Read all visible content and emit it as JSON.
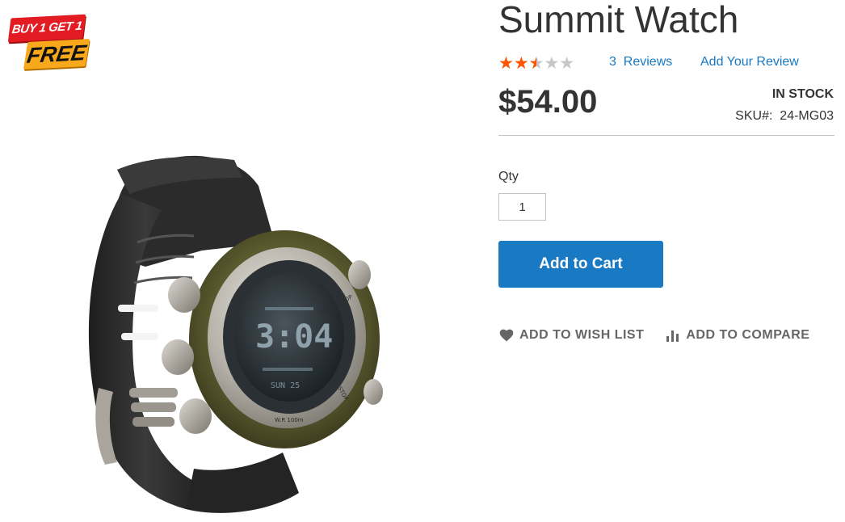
{
  "promo_badge": {
    "line1": "BUY 1 GET 1",
    "line2": "FREE"
  },
  "product": {
    "title": "Summit Watch",
    "rating": {
      "value": 2.5,
      "max": 5,
      "fill_color": "#ff5501",
      "empty_color": "#c7c7c7"
    },
    "reviews_link": "3  Reviews",
    "add_review_link": "Add Your Review",
    "price": "$54.00",
    "stock_status": "In stock",
    "sku_text": "SKU#:  24-MG03",
    "qty_label": "Qty",
    "qty_value": "1",
    "add_to_cart_label": "Add to Cart",
    "wishlist_label": "Add to Wish List",
    "compare_label": "Add to Compare",
    "image_alt": "Summit Watch"
  },
  "colors": {
    "accent": "#1979c3",
    "text": "#333333",
    "secondary_text": "#666666"
  },
  "icons": {
    "wishlist": "heart-icon",
    "compare": "bar-chart-icon"
  }
}
